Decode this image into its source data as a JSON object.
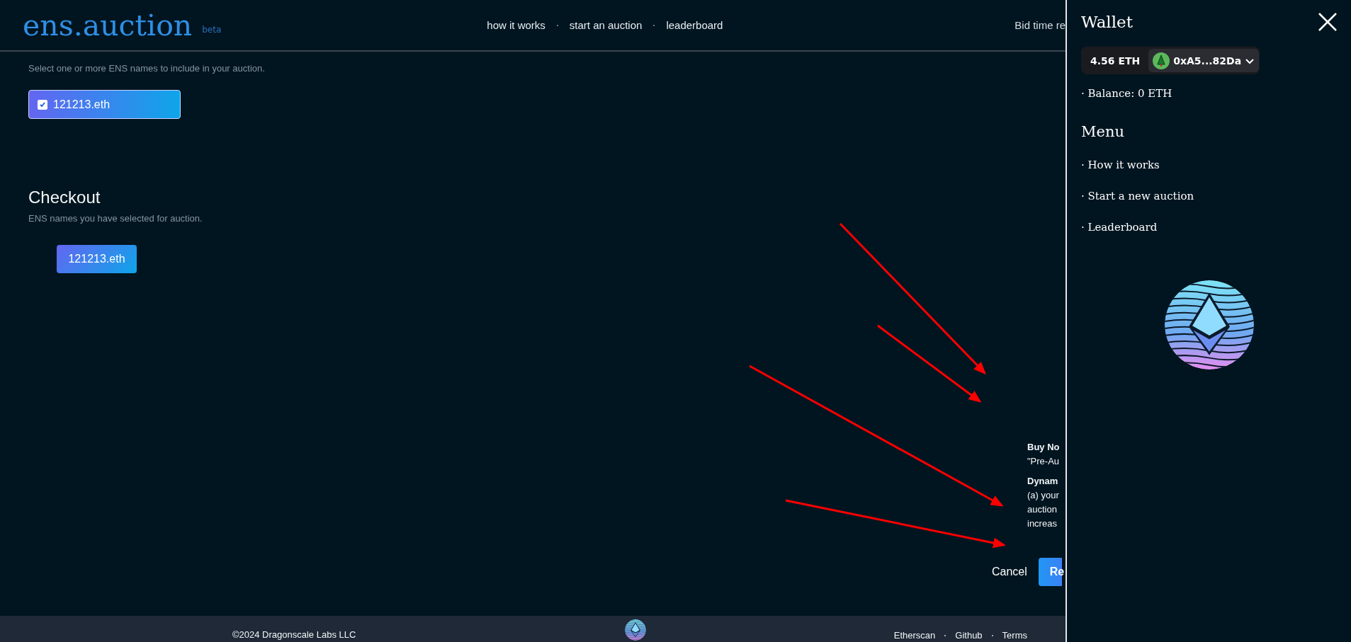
{
  "header": {
    "logo": "ens.auction",
    "badge": "beta",
    "nav": [
      "how it works",
      "start an auction",
      "leaderboard"
    ],
    "bid_time": "Bid time re"
  },
  "select_section": {
    "subtitle": "Select one or more ENS names to include in your auction.",
    "names": [
      {
        "label": "121213.eth",
        "checked": true
      }
    ]
  },
  "checkout": {
    "title": "Checkout",
    "subtitle": "ENS names you have selected for auction.",
    "names": [
      "121213.eth"
    ]
  },
  "info_lines": [
    {
      "kind": "heading",
      "text": "Buy No"
    },
    {
      "kind": "body",
      "text": "\"Pre-Au"
    },
    {
      "kind": "heading",
      "text": "Dynam"
    },
    {
      "kind": "body",
      "text": "(a) your"
    },
    {
      "kind": "body",
      "text": "auction"
    },
    {
      "kind": "body",
      "text": "increas"
    }
  ],
  "actions": {
    "cancel": "Cancel",
    "primary": "Re"
  },
  "footer": {
    "copyright": "©2024 Dragonscale Labs LLC",
    "links": [
      "Etherscan",
      "Github",
      "Terms"
    ]
  },
  "drawer": {
    "title": "Wallet",
    "balance_pill": "4.56 ETH",
    "address": "0xA5...82Da",
    "balance": "· Balance: 0 ETH",
    "menu_title": "Menu",
    "menu": [
      "· How it works",
      "· Start a new auction",
      "· Leaderboard"
    ]
  }
}
